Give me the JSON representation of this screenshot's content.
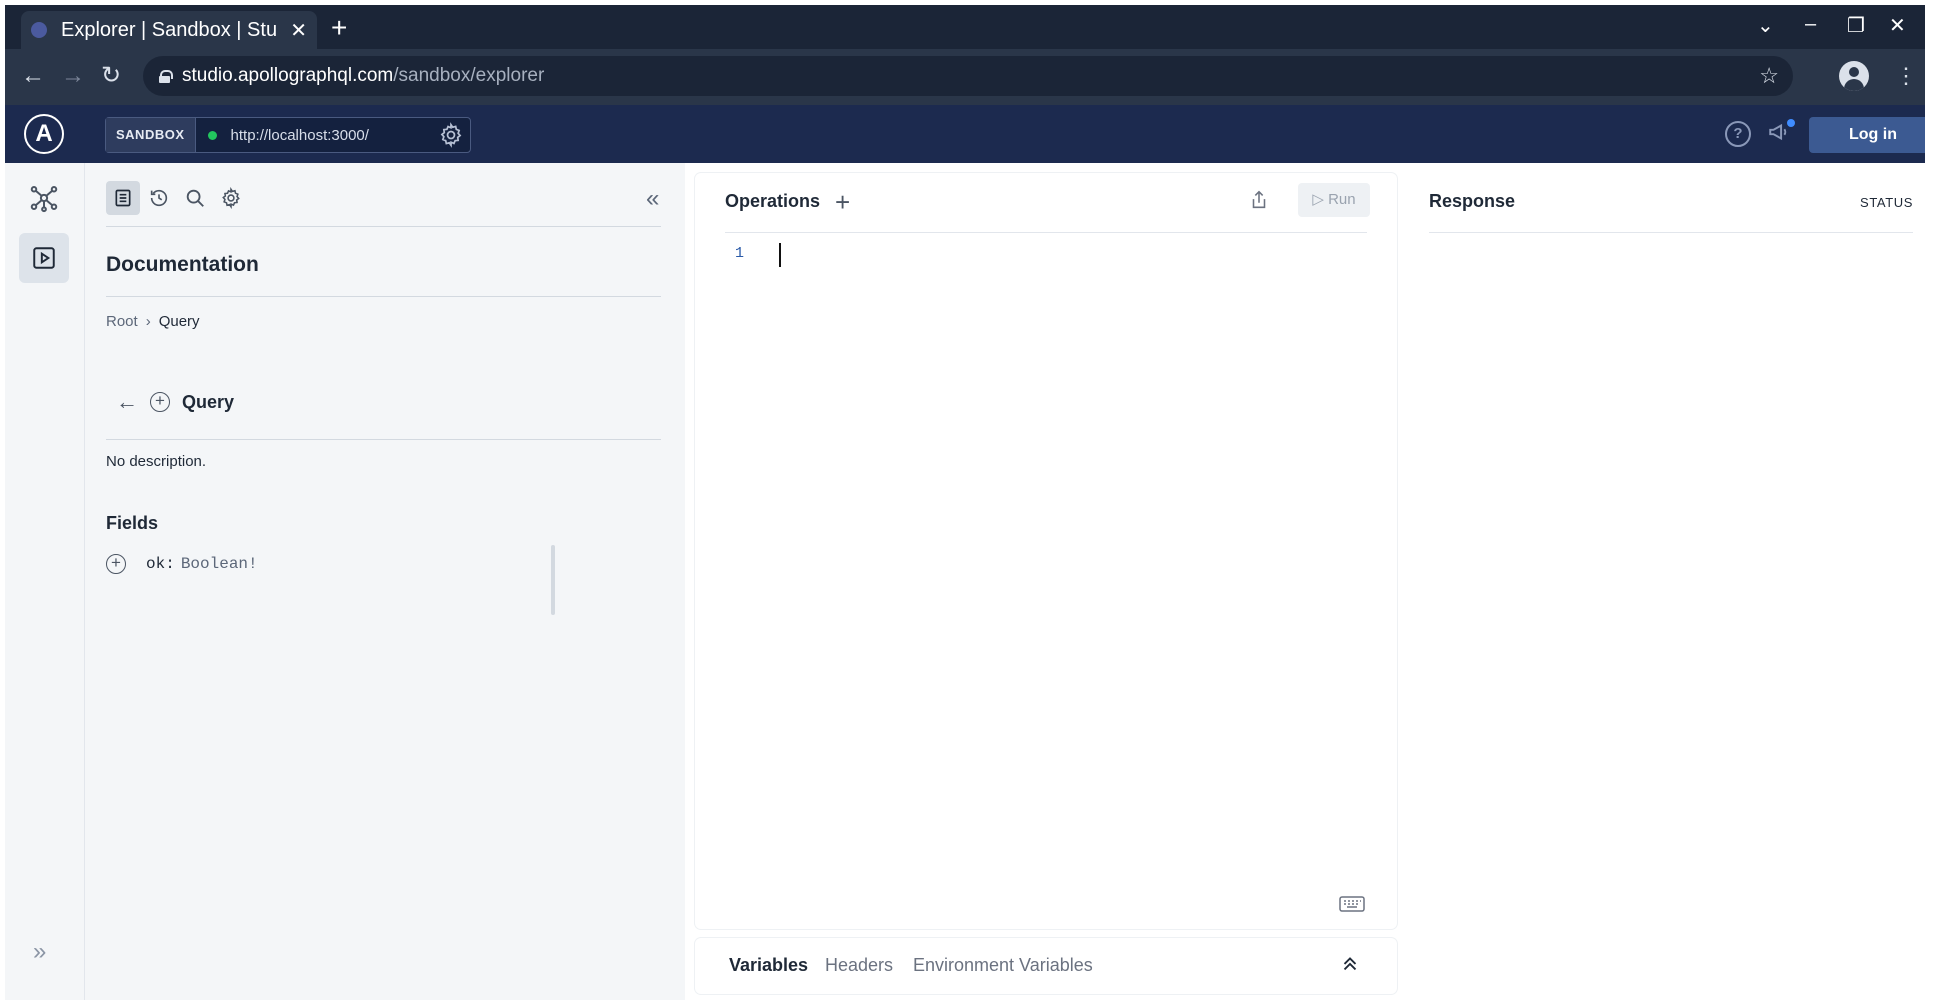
{
  "browser": {
    "tab_title": "Explorer | Sandbox | Stu",
    "tab_close": "✕",
    "new_tab": "+",
    "url_host": "studio.apollographql.com",
    "url_path": "/sandbox/explorer",
    "back": "←",
    "forward": "→",
    "reload": "↻",
    "star": "☆",
    "menu": "⋮",
    "tab_list": "⌄",
    "minimize": "–",
    "restore": "❐",
    "close": "✕"
  },
  "header": {
    "logo": "A",
    "sandbox_badge": "SANDBOX",
    "endpoint_url": "http://localhost:3000/",
    "endpoint_status_color": "#22c55e",
    "help": "?",
    "login_label": "Log in"
  },
  "rail": {
    "items": [
      {
        "icon": "schema-graph-icon",
        "active": false
      },
      {
        "icon": "explorer-play-icon",
        "active": true
      }
    ],
    "expand": "»"
  },
  "docs": {
    "toolbar": {
      "tools": [
        "documentation-icon",
        "history-icon",
        "search-icon",
        "settings-icon"
      ],
      "collapse": "«"
    },
    "title": "Documentation",
    "breadcrumb": {
      "root": "Root",
      "separator": "›",
      "current": "Query"
    },
    "type_back": "←",
    "type_name": "Query",
    "description": "No description.",
    "fields_title": "Fields",
    "fields": [
      {
        "name": "ok:",
        "type": "Boolean!"
      }
    ]
  },
  "operations": {
    "title": "Operations",
    "add": "+",
    "run_label": "▷ Run",
    "line_numbers": [
      "1"
    ]
  },
  "variables_bar": {
    "tabs": [
      "Variables",
      "Headers",
      "Environment Variables"
    ],
    "active_tab": "Variables"
  },
  "response": {
    "title": "Response",
    "status_label": "STATUS"
  }
}
